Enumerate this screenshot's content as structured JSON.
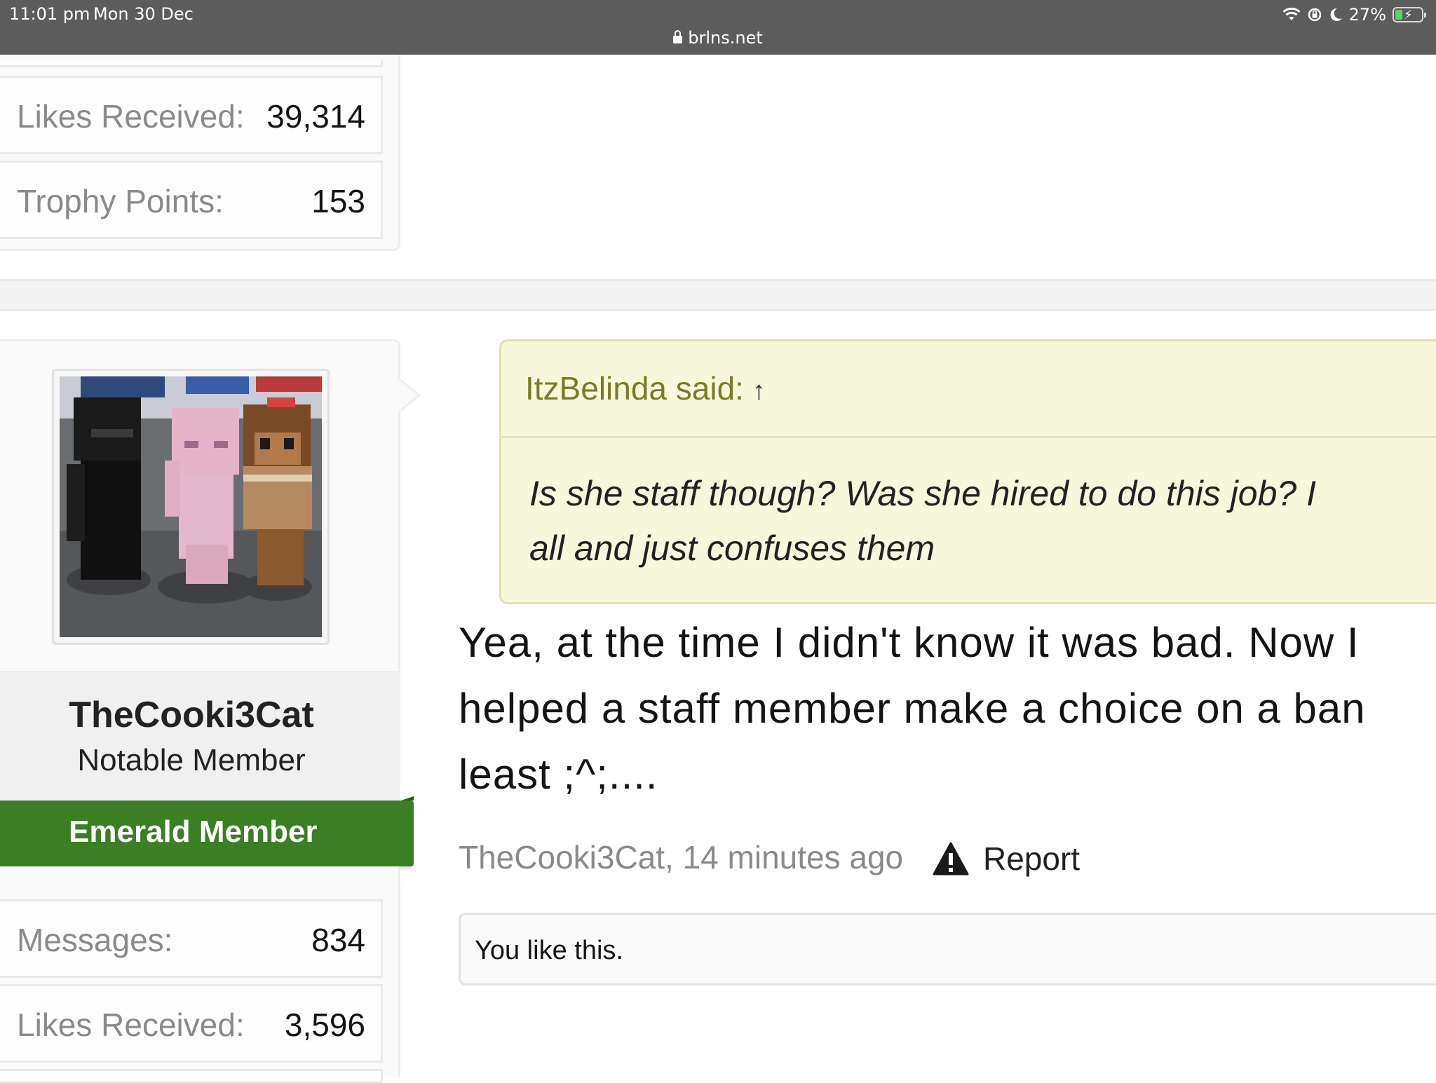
{
  "status_bar": {
    "time": "11:01 pm",
    "date": "Mon 30 Dec",
    "url": "brlns.net",
    "battery": "27%",
    "battery_level": 0.27
  },
  "previous_post": {
    "stats": [
      {
        "label": "Likes Received:",
        "value": "39,314"
      },
      {
        "label": "Trophy Points:",
        "value": "153"
      }
    ]
  },
  "post": {
    "user": {
      "name": "TheCooki3Cat",
      "title": "Notable Member",
      "banner": "Emerald Member",
      "banner_color": "#3a7f23",
      "stats": [
        {
          "label": "Messages:",
          "value": "834"
        },
        {
          "label": "Likes Received:",
          "value": "3,596"
        }
      ]
    },
    "quote": {
      "author": "ItzBelinda said:",
      "arrow": "↑",
      "lines": [
        "Is she staff though? Was she hired to do this job? I",
        "all and just confuses them"
      ]
    },
    "message_lines": [
      "Yea, at the time I didn't know it was bad. Now I",
      "helped a staff member make a choice on a ban",
      "least ;^;...."
    ],
    "meta": "TheCooki3Cat, 14 minutes ago",
    "report_label": "Report",
    "likes_text": "You like this."
  }
}
